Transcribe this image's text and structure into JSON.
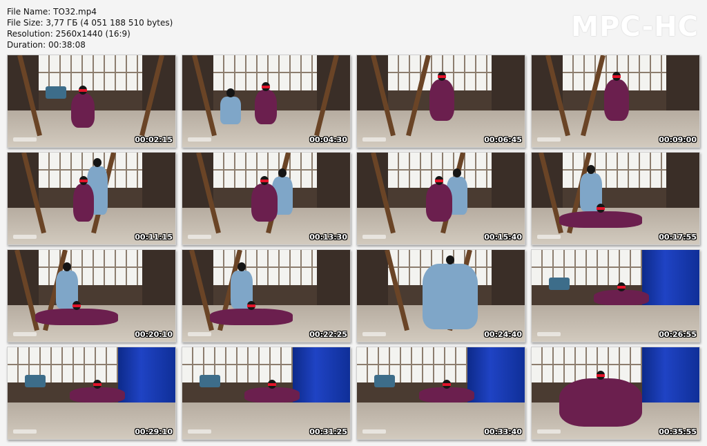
{
  "header": {
    "file_name": "File Name: TO32.mp4",
    "file_size": "File Size: 3,77 ГБ (4 051 188 510 bytes)",
    "resolution": "Resolution: 2560x1440 (16:9)",
    "duration": "Duration: 00:38:08"
  },
  "logo": "MPC-HC",
  "thumbnails": [
    {
      "time": "00:02:15",
      "scene": "kneel-center"
    },
    {
      "time": "00:04:30",
      "scene": "kneel-with-man"
    },
    {
      "time": "00:06:45",
      "scene": "suspension-partial"
    },
    {
      "time": "00:09:00",
      "scene": "suspension-partial"
    },
    {
      "time": "00:11:15",
      "scene": "standing-tie"
    },
    {
      "time": "00:13:30",
      "scene": "seated-tie"
    },
    {
      "time": "00:15:40",
      "scene": "seated-tie"
    },
    {
      "time": "00:17:55",
      "scene": "floor-lying"
    },
    {
      "time": "00:20:10",
      "scene": "floor-lying"
    },
    {
      "time": "00:22:25",
      "scene": "floor-lying"
    },
    {
      "time": "00:24:40",
      "scene": "man-crouching"
    },
    {
      "time": "00:26:55",
      "scene": "floor-curtain"
    },
    {
      "time": "00:29:10",
      "scene": "floor-curtain"
    },
    {
      "time": "00:31:25",
      "scene": "floor-curtain"
    },
    {
      "time": "00:33:40",
      "scene": "floor-curtain"
    },
    {
      "time": "00:35:55",
      "scene": "closeup"
    }
  ]
}
